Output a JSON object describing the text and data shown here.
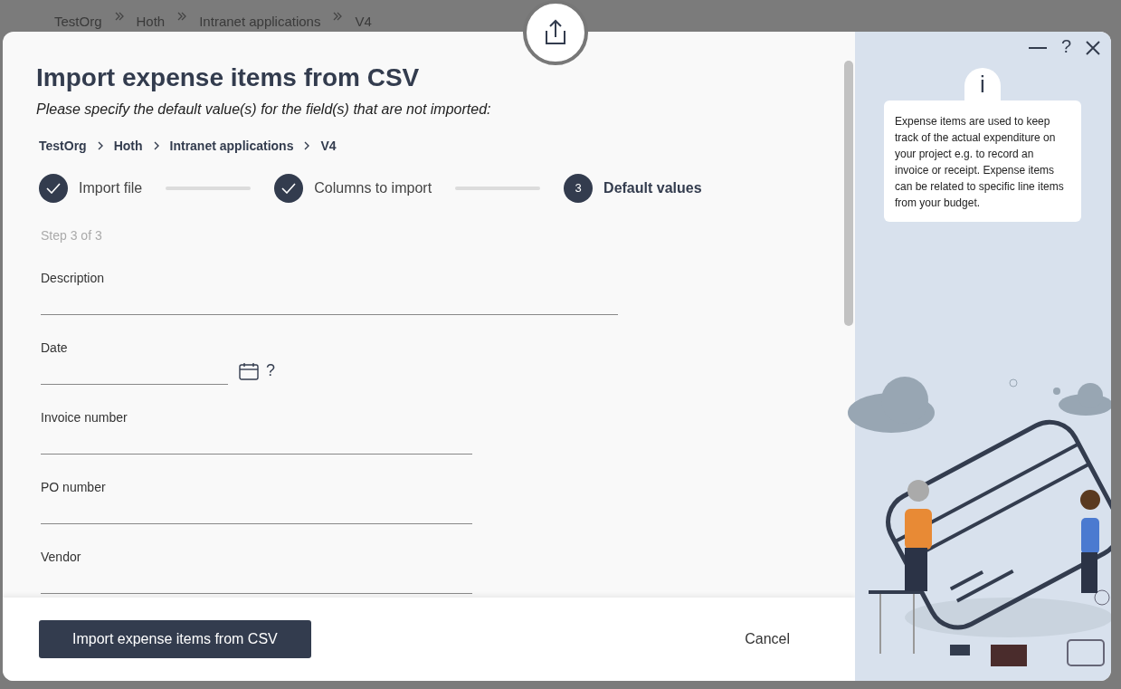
{
  "background_breadcrumb": [
    "TestOrg",
    "Hoth",
    "Intranet applications",
    "V4"
  ],
  "dialog": {
    "title": "Import expense items from CSV",
    "subtitle": "Please specify the default value(s) for the field(s) that are not imported:",
    "breadcrumb": [
      "TestOrg",
      "Hoth",
      "Intranet applications",
      "V4"
    ],
    "steps": [
      {
        "label": "Import file",
        "completed": true
      },
      {
        "label": "Columns to import",
        "completed": true
      },
      {
        "number": "3",
        "label": "Default values",
        "completed": false
      }
    ],
    "step_caption": "Step 3 of 3",
    "fields": [
      {
        "label": "Description",
        "kind": "multiline"
      },
      {
        "label": "Date",
        "kind": "date",
        "help": "?"
      },
      {
        "label": "Invoice number",
        "kind": "text"
      },
      {
        "label": "PO number",
        "kind": "text"
      },
      {
        "label": "Vendor",
        "kind": "text"
      }
    ],
    "primary_button": "Import expense items from CSV",
    "cancel_button": "Cancel"
  },
  "side_panel": {
    "info_mark": "i",
    "window_buttons": [
      "?"
    ],
    "info_text": "Expense items are used to keep track of the actual expenditure on your project e.g. to record an invoice or receipt. Expense items can be related to specific line items from your budget."
  }
}
